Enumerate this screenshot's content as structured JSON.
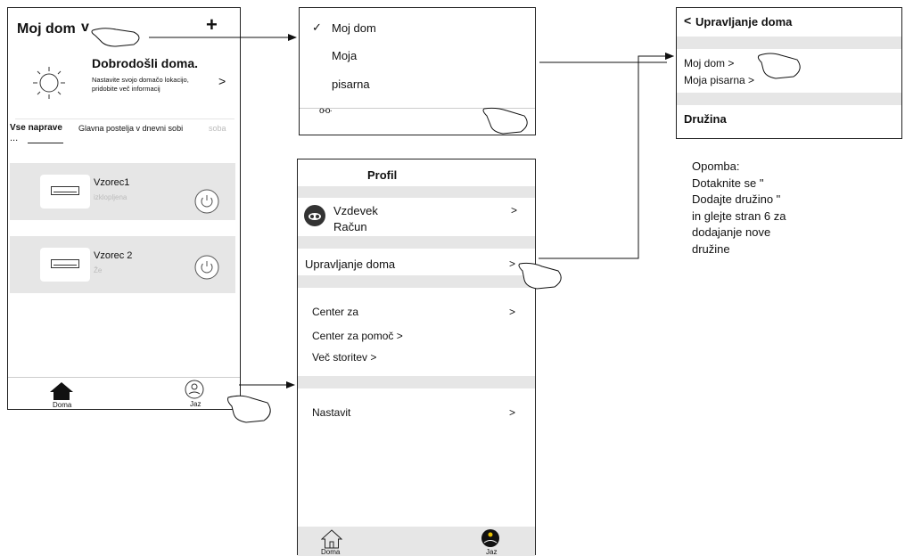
{
  "phone1": {
    "home_title": "Moj dom",
    "home_dropdown": "v",
    "add": "+",
    "welcome_title": "Dobrodošli doma.",
    "welcome_sub1": "Nastavite svojo domačo lokacijo,",
    "welcome_sub2": "pridobite več informacij",
    "welcome_arrow": ">",
    "all_devices": "Vse naprave",
    "rooms": "Glavna postelja v dnevni sobi",
    "rooms_faded": "soba",
    "more": "...",
    "devices": [
      {
        "name": "Vzorec1",
        "status": "izklopljena"
      },
      {
        "name": "Vzorec 2",
        "status": "Že"
      }
    ],
    "nav_home": "Doma",
    "nav_me": "Jaz"
  },
  "dropdown": {
    "check": "✓",
    "items": [
      "Moj dom",
      "Moja",
      "pisarna"
    ],
    "manage_icon": "o-o·"
  },
  "profile": {
    "title": "Profil",
    "nickname": "Vzdevek",
    "account": "Račun",
    "home_manage": "Upravljanje doma",
    "center": "Center za",
    "help_center": "Center za pomoč >",
    "more_services": "Več storitev >",
    "settings": "Nastavit",
    "arrow": ">",
    "nav_home": "Doma",
    "nav_me": "Jaz"
  },
  "manage": {
    "back": "<",
    "title": "Upravljanje doma",
    "home_item": "Moj dom >",
    "office_item": "Moja pisarna >",
    "family": "Družina"
  },
  "note": {
    "lines": [
      "Opomba:",
      "Dotaknite se \"",
      "Dodajte družino \"",
      "in glejte stran 6 za",
      "dodajanje nove",
      "družine"
    ]
  },
  "colors": {
    "panel_gray": "#e6e6e6",
    "line": "#222222",
    "faded": "#bbbbbb"
  }
}
